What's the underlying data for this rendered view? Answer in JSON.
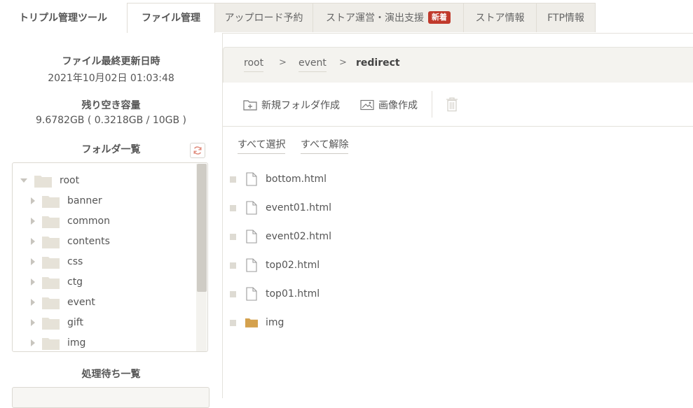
{
  "nav": {
    "brand": "トリプル管理ツール",
    "tabs": [
      {
        "label": "ファイル管理",
        "active": true
      },
      {
        "label": "アップロード予約",
        "active": false
      },
      {
        "label": "ストア運営・演出支援",
        "badge": "新着",
        "active": false
      },
      {
        "label": "ストア情報",
        "active": false
      },
      {
        "label": "FTP情報",
        "active": false
      }
    ]
  },
  "sidebar": {
    "last_updated_label": "ファイル最終更新日時",
    "last_updated_value": "2021年10月02日 01:03:48",
    "capacity_label": "残り空き容量",
    "capacity_value": "9.6782GB ( 0.3218GB / 10GB )",
    "folder_list_label": "フォルダ一覧",
    "tree": {
      "root": "root",
      "children": [
        "banner",
        "common",
        "contents",
        "css",
        "ctg",
        "event",
        "gift",
        "img"
      ]
    },
    "queue_label": "処理待ち一覧"
  },
  "breadcrumb": {
    "items": [
      "root",
      "event",
      "redirect"
    ],
    "separator": ">"
  },
  "toolbar": {
    "new_folder": "新規フォルダ作成",
    "create_image": "画像作成"
  },
  "selection": {
    "select_all": "すべて選択",
    "deselect_all": "すべて解除"
  },
  "files": [
    {
      "name": "bottom.html",
      "type": "file"
    },
    {
      "name": "event01.html",
      "type": "file"
    },
    {
      "name": "event02.html",
      "type": "file"
    },
    {
      "name": "top02.html",
      "type": "file"
    },
    {
      "name": "top01.html",
      "type": "file"
    },
    {
      "name": "img",
      "type": "folder"
    }
  ],
  "colors": {
    "badge": "#c0392b",
    "folder_tree": "#e6e2d8",
    "folder_main": "#d4a14e"
  }
}
